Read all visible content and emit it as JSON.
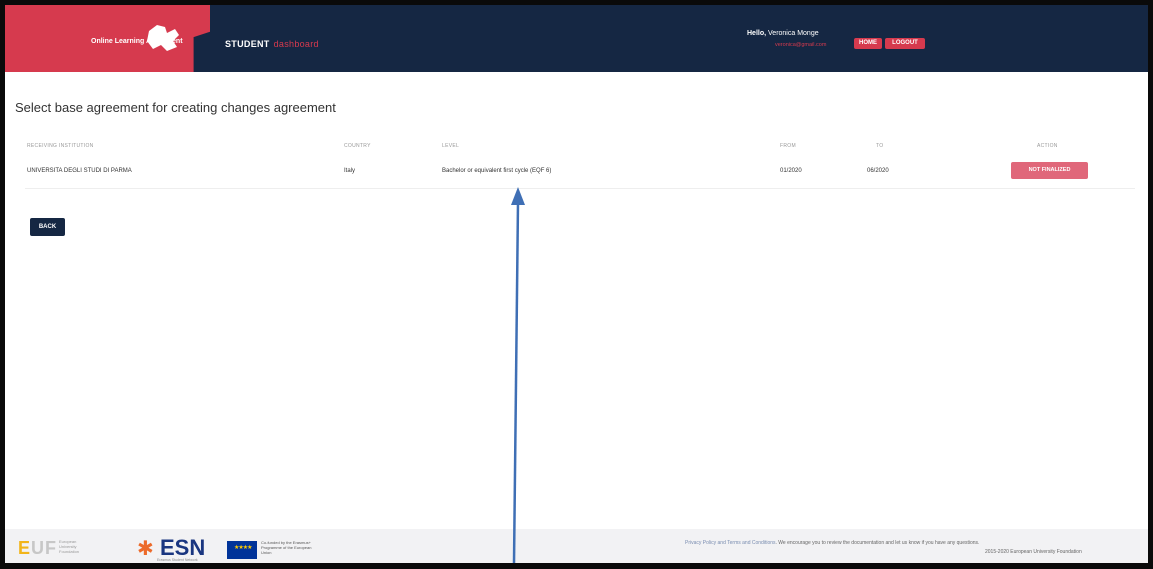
{
  "header": {
    "logo_text": "Online Learning Agreement",
    "app_label": "STUDENT",
    "app_sub": "dashboard",
    "hello_prefix": "Hello,",
    "user_name": "Veronica Monge",
    "user_email": "veronica@gmail.com",
    "home_label": "HOME",
    "logout_label": "LOGOUT"
  },
  "main": {
    "title": "Select base agreement for creating changes agreement",
    "columns": [
      "RECEIVING INSTITUTION",
      "COUNTRY",
      "LEVEL",
      "FROM",
      "TO",
      "ACTION"
    ],
    "rows": [
      {
        "institution": "UNIVERSITA DEGLI STUDI DI PARMA",
        "country": "Italy",
        "level": "Bachelor or equivalent first cycle (EQF 6)",
        "from": "01/2020",
        "to": "06/2020",
        "action": "NOT FINALIZED"
      }
    ],
    "back_label": "BACK"
  },
  "footer": {
    "euf_sub": "European University Foundation",
    "esn_label": "ESN",
    "esn_sub": "Erasmus Student Network",
    "eu_text": "Co-funded by the Erasmus+ Programme of the European Union",
    "privacy_link": "Privacy Policy and Terms and Conditions",
    "note": "We encourage you to review the documentation and let us know if you have any questions.",
    "copyright": "2015-2020 European University Foundation"
  },
  "colors": {
    "navy": "#152743",
    "accent_red": "#d63a4e",
    "pink_button": "#e0677a",
    "annotation_arrow": "#3f6fb5"
  },
  "annotation": {
    "icon": "arrow-up-icon"
  }
}
